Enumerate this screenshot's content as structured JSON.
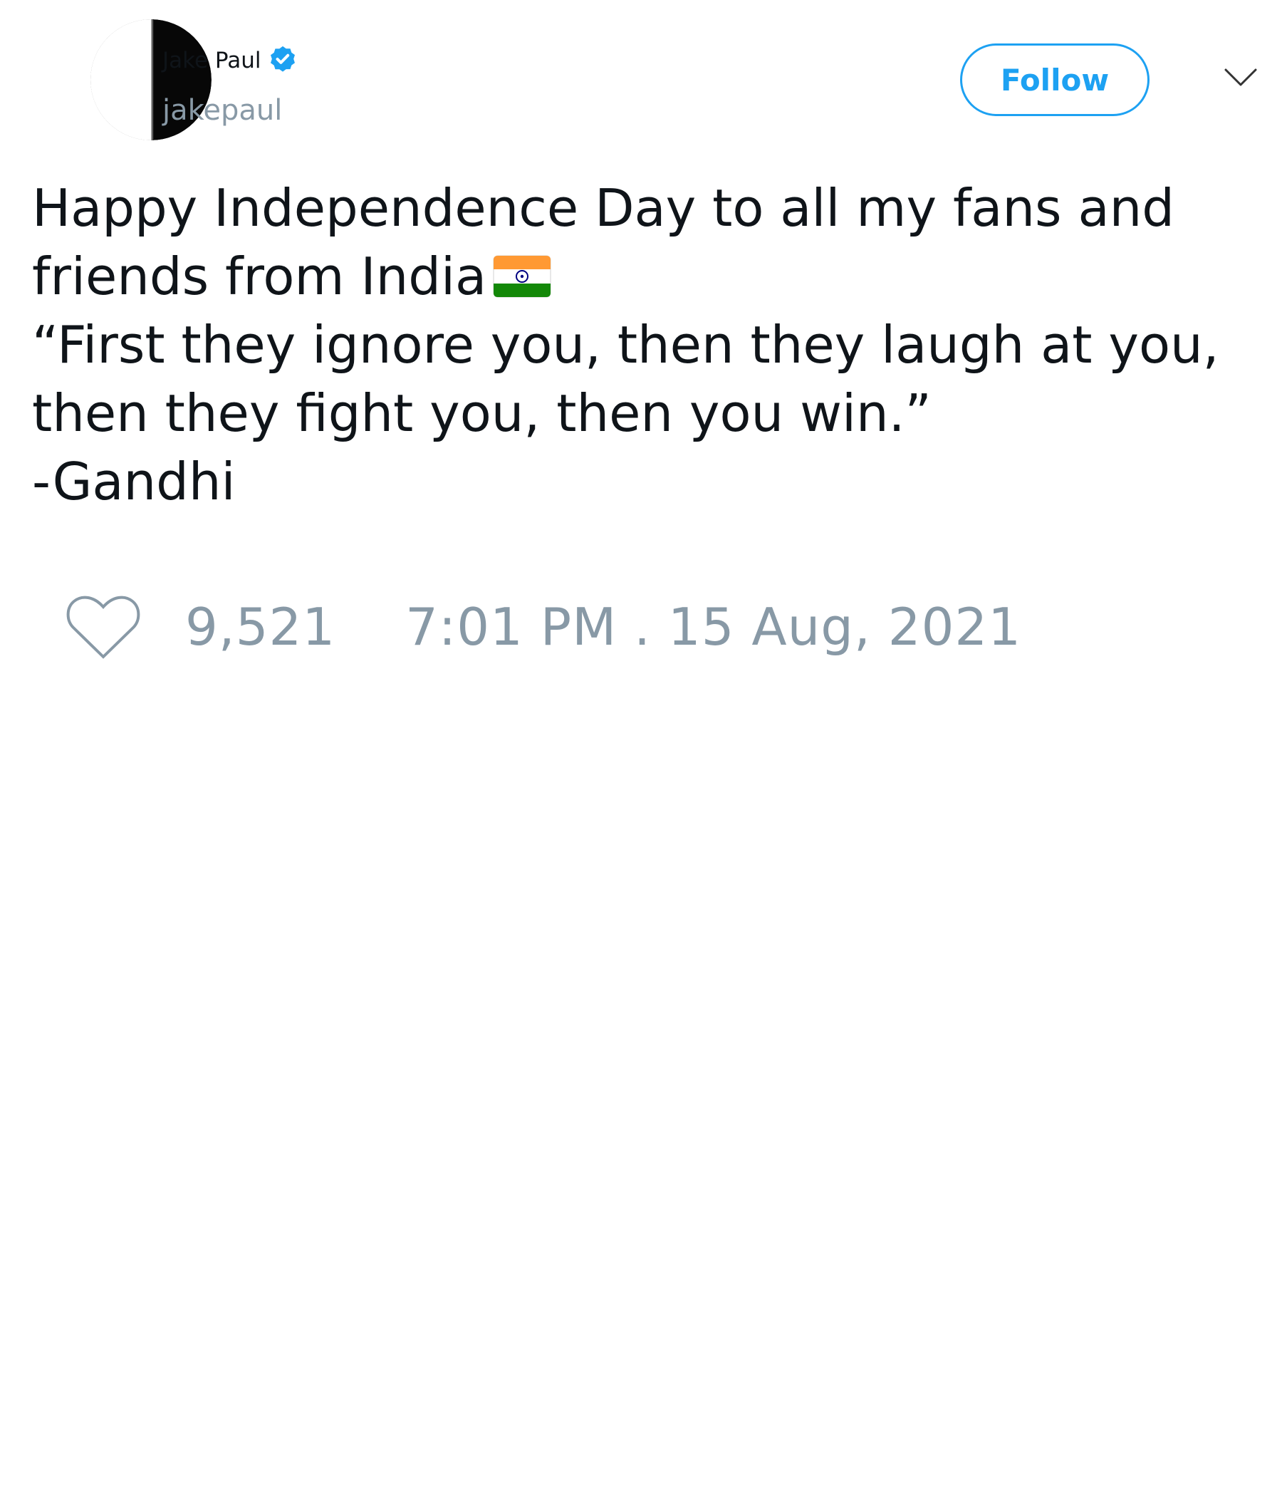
{
  "author": {
    "display_name": "Jake Paul",
    "handle": "jakepaul",
    "verified": true,
    "avatar_icon": "avatar-half-black-circle"
  },
  "header": {
    "follow_label": "Follow",
    "menu_icon": "chevron-down-icon"
  },
  "tweet": {
    "lines": [
      "Happy Independence Day to all my fans and",
      "friends from India",
      "“First they ignore you, then they laugh at you,",
      "then they fight you, then you win.”",
      "-Gandhi"
    ],
    "emoji": "india-flag-icon"
  },
  "footer": {
    "like_icon": "heart-icon",
    "like_count": "9,521",
    "timestamp": "7:01 PM . 15 Aug, 2021"
  },
  "colors": {
    "accent": "#1da1f2",
    "muted": "#8899a6",
    "text": "#0f1419",
    "flag_saffron": "#ff9933",
    "flag_green": "#138808",
    "flag_chakra": "#000080"
  }
}
